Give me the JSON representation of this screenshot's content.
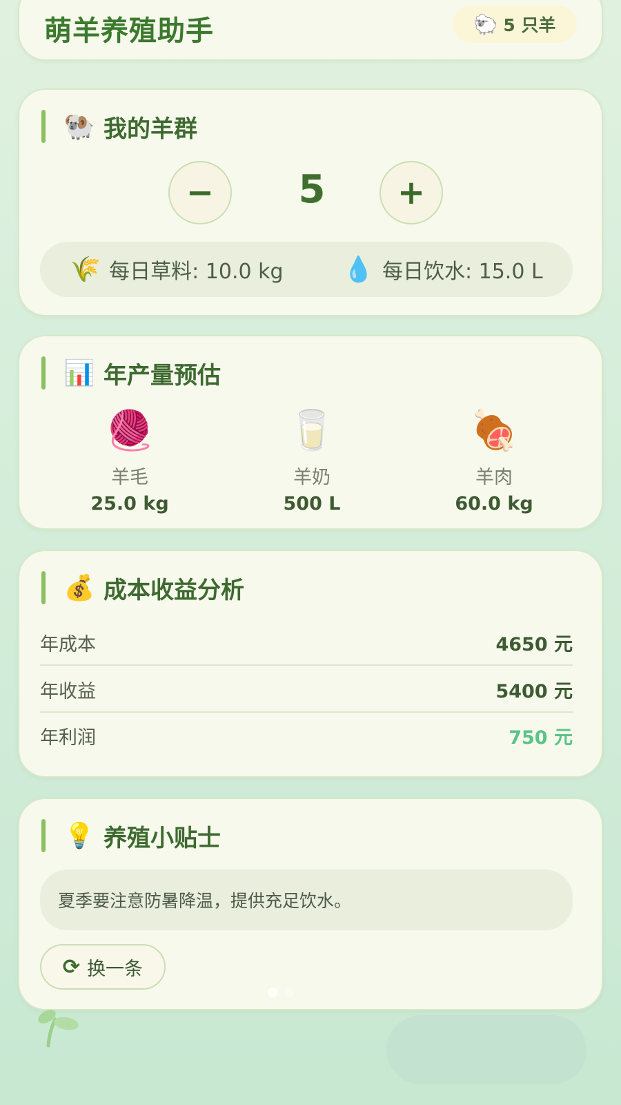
{
  "header": {
    "title": "萌羊养殖助手",
    "sheep_badge_icon": "sheep-icon",
    "sheep_badge": "5 只羊"
  },
  "flock": {
    "title": "我的羊群",
    "icon": "ram-icon",
    "count": "5",
    "minus_label": "−",
    "plus_label": "+",
    "daily_feed": {
      "icon": "wheat-icon",
      "text": "每日草料: 10.0 kg"
    },
    "daily_water": {
      "icon": "droplet-icon",
      "text": "每日饮水: 15.0 L"
    }
  },
  "yield": {
    "title": "年产量预估",
    "icon": "bar-chart-icon",
    "items": [
      {
        "icon": "yarn-icon",
        "label": "羊毛",
        "value": "25.0 kg"
      },
      {
        "icon": "milk-glass-icon",
        "label": "羊奶",
        "value": "500 L"
      },
      {
        "icon": "meat-icon",
        "label": "羊肉",
        "value": "60.0 kg"
      }
    ]
  },
  "finance": {
    "title": "成本收益分析",
    "icon": "money-bag-icon",
    "rows": [
      {
        "label": "年成本",
        "value": "4650 元"
      },
      {
        "label": "年收益",
        "value": "5400 元"
      },
      {
        "label": "年利润",
        "value": "750 元"
      }
    ],
    "profit_color": "#5cc289"
  },
  "tips": {
    "title": "养殖小贴士",
    "icon": "light-bulb-icon",
    "text": "夏季要注意防暑降温，提供充足饮水。",
    "refresh_icon": "refresh-icon",
    "refresh_label": "换一条"
  },
  "colors": {
    "accent_green": "#3c7a2e",
    "section_bar": "#8cc05e",
    "card_bg": "#f6f9ec"
  }
}
